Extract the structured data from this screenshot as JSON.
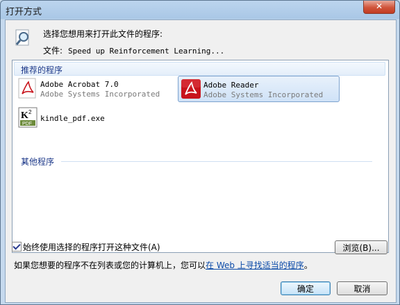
{
  "window": {
    "title": "打开方式",
    "close_label": "✕"
  },
  "prompt": {
    "text": "选择您想用来打开此文件的程序:",
    "file_label": "文件:",
    "file_name": "Speed up Reinforcement Learning..."
  },
  "list": {
    "recommended_header": "推荐的程序",
    "apps": [
      {
        "name": "Adobe Acrobat 7.0",
        "publisher": "Adobe Systems Incorporated",
        "icon": "acrobat-icon"
      },
      {
        "name": "Adobe Reader",
        "publisher": "Adobe Systems Incorporated",
        "icon": "adobe-reader-icon",
        "selected": true
      },
      {
        "name": "kindle_pdf.exe",
        "publisher": "",
        "icon": "kindle-pdf-icon"
      }
    ],
    "other_header": "其他程序"
  },
  "options": {
    "always_use_label": "始终使用选择的程序打开这种文件(A)",
    "always_use_checked": true,
    "browse_label": "浏览(B)..."
  },
  "hint": {
    "prefix": "如果您想要的程序不在列表或您的计算机上，您可以",
    "link": "在 Web 上寻找适当的程序",
    "suffix": "。"
  },
  "buttons": {
    "ok": "确定",
    "cancel": "取消"
  },
  "colors": {
    "accent": "#1e3a8a",
    "link": "#0b4aa8",
    "adobe_red": "#c8141c"
  }
}
